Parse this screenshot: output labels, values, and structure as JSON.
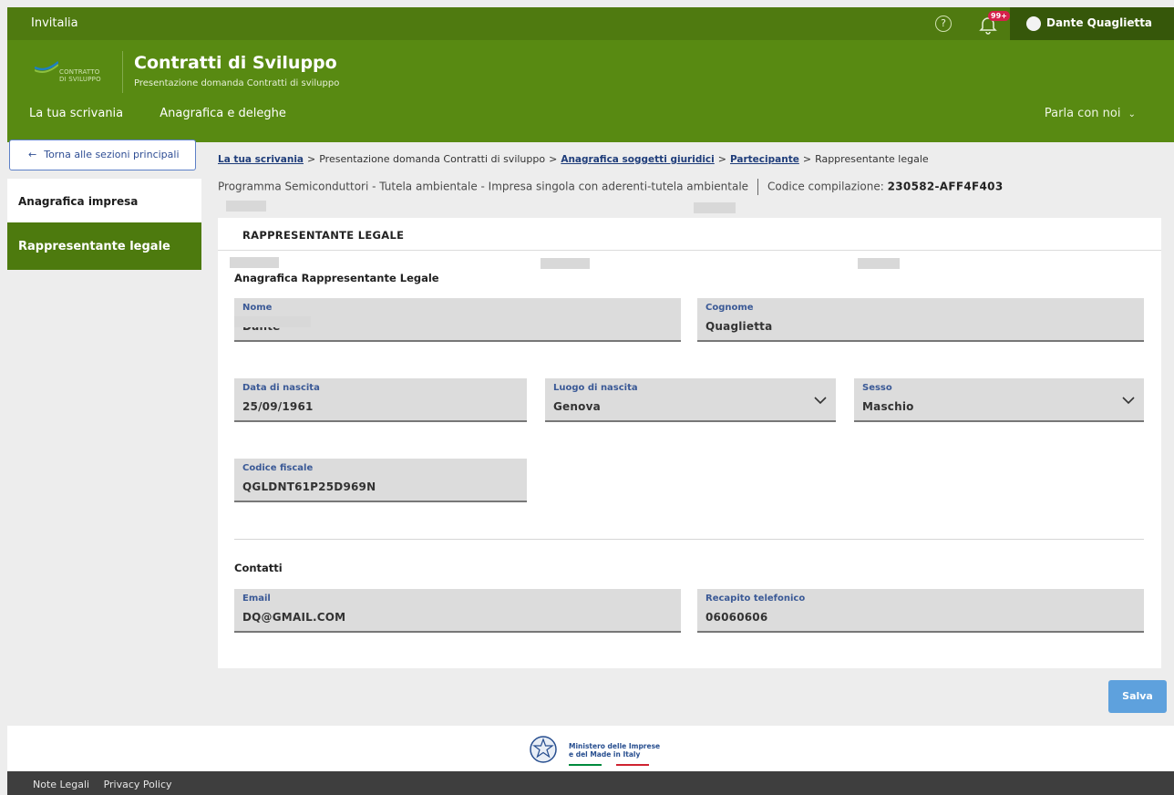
{
  "topbar": {
    "brand": "Invitalia",
    "help_icon": "?",
    "notifications_badge": "99+",
    "user_name": "Dante Quaglietta"
  },
  "header": {
    "logo_text_1": "CONTRATTO",
    "logo_text_2": "DI SVILUPPO",
    "title": "Contratti di Sviluppo",
    "subtitle": "Presentazione domanda Contratti di sviluppo",
    "nav": [
      "La tua scrivania",
      "Anagrafica e deleghe"
    ],
    "chat": "Parla con noi"
  },
  "sidebar": {
    "back": "Torna alle sezioni principali",
    "items": [
      "Anagrafica impresa",
      "Rappresentante legale"
    ]
  },
  "breadcrumb": {
    "items": [
      {
        "label": "La tua scrivania",
        "link": true
      },
      {
        "label": "Presentazione domanda Contratti di sviluppo",
        "link": false
      },
      {
        "label": "Anagrafica soggetti giuridici",
        "link": true
      },
      {
        "label": "Partecipante",
        "link": true
      },
      {
        "label": "Rappresentante legale",
        "link": false
      }
    ],
    "separator": ">"
  },
  "program": {
    "description": "Programma Semiconduttori - Tutela ambientale  -  Impresa singola con aderenti-tutela ambientale",
    "code_label": "Codice compilazione:",
    "code_value": "230582-AFF4F403"
  },
  "card": {
    "title": "RAPPRESENTANTE LEGALE",
    "section_anagrafica": "Anagrafica Rappresentante Legale",
    "section_contatti": "Contatti"
  },
  "fields": {
    "nome": {
      "label": "Nome",
      "value": "Dante"
    },
    "cognome": {
      "label": "Cognome",
      "value": "Quaglietta"
    },
    "data_nascita": {
      "label": "Data di nascita",
      "value": "25/09/1961"
    },
    "luogo_nascita": {
      "label": "Luogo di nascita",
      "value": "Genova"
    },
    "sesso": {
      "label": "Sesso",
      "value": "Maschio"
    },
    "codice_fiscale": {
      "label": "Codice fiscale",
      "value": "QGLDNT61P25D969N"
    },
    "email": {
      "label": "Email",
      "value": "DQ@GMAIL.COM"
    },
    "telefono": {
      "label": "Recapito telefonico",
      "value": "06060606"
    }
  },
  "actions": {
    "save": "Salva"
  },
  "footer": {
    "ministry_line1": "Ministero delle Imprese",
    "ministry_line2": "e del Made in Italy",
    "links": [
      "Note Legali",
      "Privacy Policy"
    ]
  },
  "colors": {
    "topbar": "#4f7a10",
    "header": "#588a12",
    "active_sidebar": "#4d7a0e",
    "link_blue": "#1f3d7a",
    "save_button": "#5ea1dd"
  }
}
